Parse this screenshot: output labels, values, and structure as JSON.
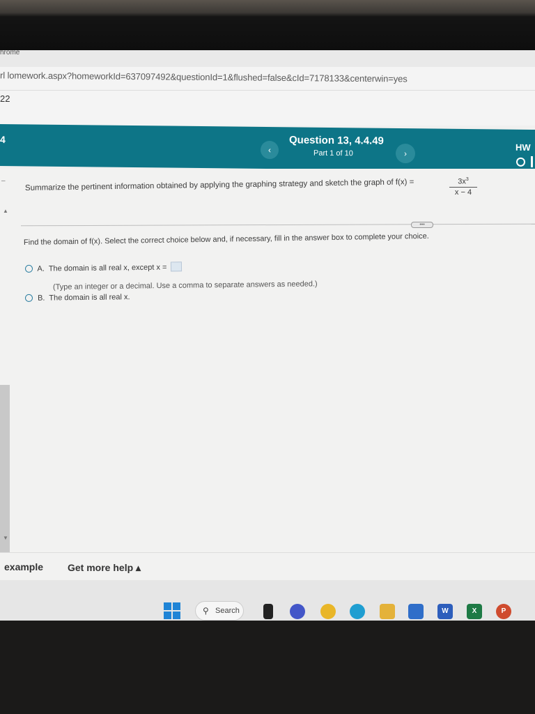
{
  "browser": {
    "app_name": "hrome",
    "url": "rl lomework.aspx?homeworkId=637097492&questionId=1&flushed=false&cId=7178133&centerwin=yes",
    "sub_text": "22"
  },
  "header": {
    "left_number": "4",
    "prev_label": "‹",
    "next_label": "›",
    "question_title": "Question 13, 4.4.49",
    "question_part": "Part 1 of 10",
    "hw_label": "HW"
  },
  "question": {
    "prompt": "Summarize the pertinent information obtained by applying the graphing strategy and sketch the graph of f(x) =",
    "fraction_numerator": "3x",
    "fraction_exponent": "3",
    "fraction_denominator": "x − 4",
    "more_label": "•••"
  },
  "part": {
    "instruction": "Find the domain of f(x). Select the correct choice below and, if necessary, fill in the answer box to complete your choice.",
    "choices": [
      {
        "letter": "A.",
        "text": "The domain is all real x, except x ="
      },
      {
        "letter": "B.",
        "text": "The domain is all real x."
      }
    ],
    "hint": "(Type an integer or a decimal. Use a comma to separate answers as needed.)"
  },
  "footer": {
    "example_label": "example",
    "help_label": "Get more help ▴"
  },
  "taskbar": {
    "search_label": "Search"
  }
}
